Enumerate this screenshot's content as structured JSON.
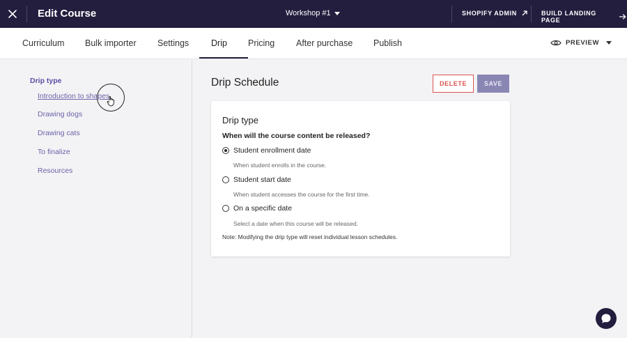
{
  "topbar": {
    "title": "Edit Course",
    "course_name": "Workshop #1",
    "shopify_admin": "SHOPIFY ADMIN",
    "build_landing_page": "BUILD LANDING PAGE",
    "bg_color": "#231d3e"
  },
  "tabs": [
    {
      "label": "Curriculum",
      "active": false
    },
    {
      "label": "Bulk importer",
      "active": false
    },
    {
      "label": "Settings",
      "active": false
    },
    {
      "label": "Drip",
      "active": true
    },
    {
      "label": "Pricing",
      "active": false
    },
    {
      "label": "After purchase",
      "active": false
    },
    {
      "label": "Publish",
      "active": false
    }
  ],
  "preview": {
    "label": "PREVIEW"
  },
  "sidebar": {
    "heading": "Drip type",
    "items": [
      {
        "label": "Introduction to shapes"
      },
      {
        "label": "Drawing dogs"
      },
      {
        "label": "Drawing cats"
      },
      {
        "label": "To finalize"
      },
      {
        "label": "Resources"
      }
    ]
  },
  "main": {
    "title": "Drip Schedule",
    "delete_label": "DELETE",
    "save_label": "SAVE",
    "card": {
      "title": "Drip type",
      "question": "When will the course content be released?",
      "options": [
        {
          "label": "Student enrollment date",
          "description": "When student enrolls in the course.",
          "checked": true
        },
        {
          "label": "Student start date",
          "description": "When student accesses the course for the first time.",
          "checked": false
        },
        {
          "label": "On a specific date",
          "description": "Select a date when this course will be released.",
          "checked": false
        }
      ],
      "note": "Note: Modifying the drip type will reset individual lesson schedules."
    }
  },
  "colors": {
    "accent": "#5b4ea5",
    "danger": "#d9534f",
    "save_disabled": "#8a86b4"
  }
}
